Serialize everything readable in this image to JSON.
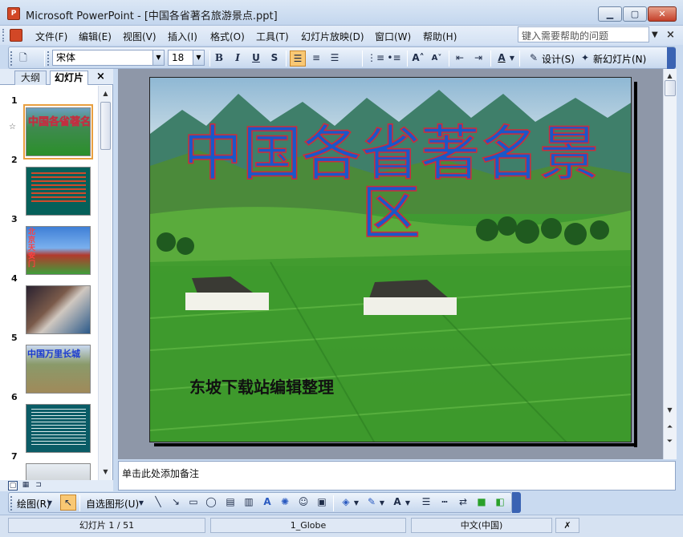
{
  "window": {
    "title": "Microsoft PowerPoint - [中国各省著名旅游景点.ppt]",
    "app_icon_letter": "P"
  },
  "menu": {
    "items": [
      "文件(F)",
      "编辑(E)",
      "视图(V)",
      "插入(I)",
      "格式(O)",
      "工具(T)",
      "幻灯片放映(D)",
      "窗口(W)",
      "帮助(H)"
    ],
    "help_placeholder": "键入需要帮助的问题"
  },
  "format_toolbar": {
    "font_name": "宋体",
    "font_size": "18",
    "bold": "B",
    "italic": "I",
    "underline": "U",
    "shadow": "S",
    "design_label": "设计(S)",
    "new_slide_label": "新幻灯片(N)"
  },
  "left_panel": {
    "tab_outline": "大纲",
    "tab_slides": "幻灯片",
    "close_glyph": "×",
    "slides": [
      {
        "number": "1",
        "thumb_text": "中国各省著名景区"
      },
      {
        "number": "2",
        "thumb_text": ""
      },
      {
        "number": "3",
        "thumb_text": "北京天安门"
      },
      {
        "number": "4",
        "thumb_text": ""
      },
      {
        "number": "5",
        "thumb_text": "中国万里长城"
      },
      {
        "number": "6",
        "thumb_text": ""
      },
      {
        "number": "7",
        "thumb_text": ""
      }
    ]
  },
  "slide": {
    "title": "中国各省著名景区",
    "subtitle": "东坡下载站编辑整理"
  },
  "notes": {
    "placeholder": "单击此处添加备注"
  },
  "draw_toolbar": {
    "draw_label": "绘图(R)",
    "autoshapes_label": "自选图形(U)"
  },
  "status": {
    "slide_position": "幻灯片 1 / 51",
    "template": "1_Globe",
    "language": "中文(中国)"
  },
  "colors": {
    "title_fill": "#1a58c8",
    "title_outline": "#cf2b3a",
    "accent_toolbar": "#3a63b3"
  }
}
